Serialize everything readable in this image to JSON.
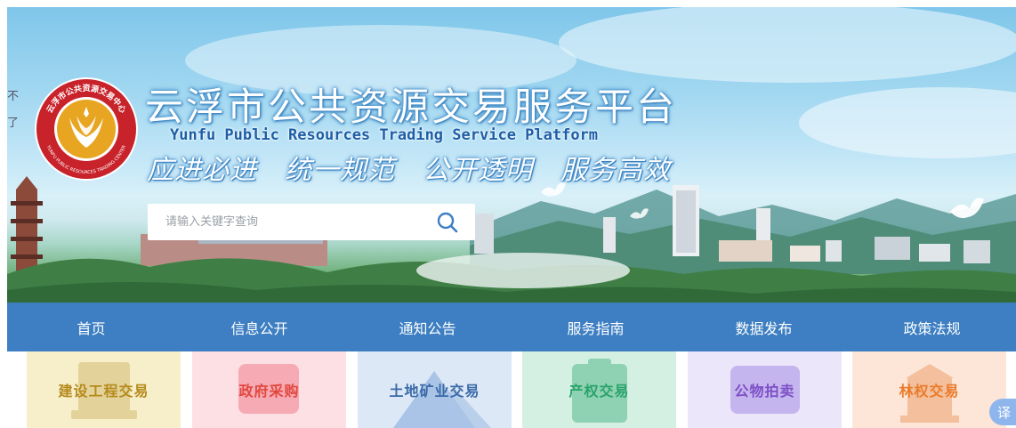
{
  "banner": {
    "edge_text": [
      "不",
      "了"
    ],
    "logo_ring_text": "云浮市公共资源交易中心",
    "logo_ring_text_en": "YUNFU PUBLIC RESOURCES TRADING CENTER",
    "title_cn": "云浮市公共资源交易服务平台",
    "title_en": "Yunfu Public Resources Trading Service Platform",
    "slogan": "应进必进　统一规范　公开透明　服务高效"
  },
  "search": {
    "placeholder": "请输入关键字查询",
    "value": ""
  },
  "nav": [
    {
      "label": "首页"
    },
    {
      "label": "信息公开"
    },
    {
      "label": "通知公告"
    },
    {
      "label": "服务指南"
    },
    {
      "label": "数据发布"
    },
    {
      "label": "政策法规"
    }
  ],
  "categories": [
    {
      "label": "建设工程交易",
      "bg": "#f6efc9",
      "deco": "#e3d39a",
      "text": "#b58a1c"
    },
    {
      "label": "政府采购",
      "bg": "#fde0e3",
      "deco": "#f6aab3",
      "text": "#e2473f"
    },
    {
      "label": "土地矿业交易",
      "bg": "#dce8f6",
      "deco": "#a9c4e6",
      "text": "#3a6aa8"
    },
    {
      "label": "产权交易",
      "bg": "#d4f0e3",
      "deco": "#8fd2b3",
      "text": "#2aa36b"
    },
    {
      "label": "公物拍卖",
      "bg": "#ece6fa",
      "deco": "#c5b5ee",
      "text": "#7d4fc6"
    },
    {
      "label": "林权交易",
      "bg": "#fde6d8",
      "deco": "#f3bf9d",
      "text": "#ea7b2b"
    }
  ],
  "translate_badge": "译",
  "colors": {
    "nav_bg": "#3d7fc2",
    "logo_red": "#c8232b",
    "logo_gold": "#e7a521"
  }
}
